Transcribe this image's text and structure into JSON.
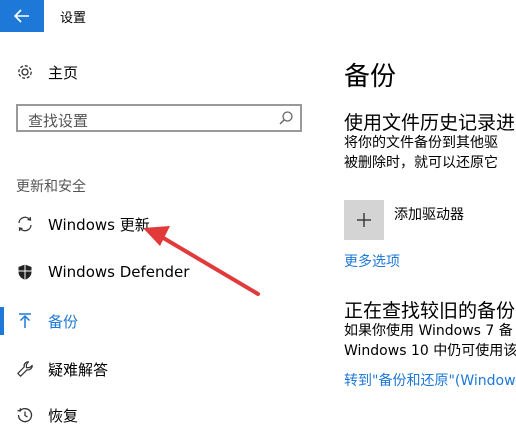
{
  "window": {
    "title": "设置"
  },
  "sidebar": {
    "home_label": "主页",
    "search_placeholder": "查找设置",
    "section_label": "更新和安全",
    "items": [
      {
        "label": "Windows 更新",
        "icon": "sync-icon"
      },
      {
        "label": "Windows Defender",
        "icon": "shield-icon"
      },
      {
        "label": "备份",
        "icon": "backup-arrow-icon",
        "active": true
      },
      {
        "label": "疑难解答",
        "icon": "wrench-icon"
      },
      {
        "label": "恢复",
        "icon": "history-icon"
      }
    ]
  },
  "main": {
    "title": "备份",
    "file_history": {
      "heading": "使用文件历史记录进",
      "desc_line1": "将你的文件备份到其他驱",
      "desc_line2": "被删除时，就可以还原它"
    },
    "add_drive_label": "添加驱动器",
    "more_options_link": "更多选项",
    "old_backup": {
      "heading": "正在查找较旧的备份",
      "desc_line1": "如果你使用 Windows 7 备",
      "desc_line2": "Windows 10 中仍可使用该",
      "link": "转到\"备份和还原\"(Window"
    }
  },
  "colors": {
    "accent": "#1e78d7",
    "annotation_arrow": "#e2393a"
  }
}
